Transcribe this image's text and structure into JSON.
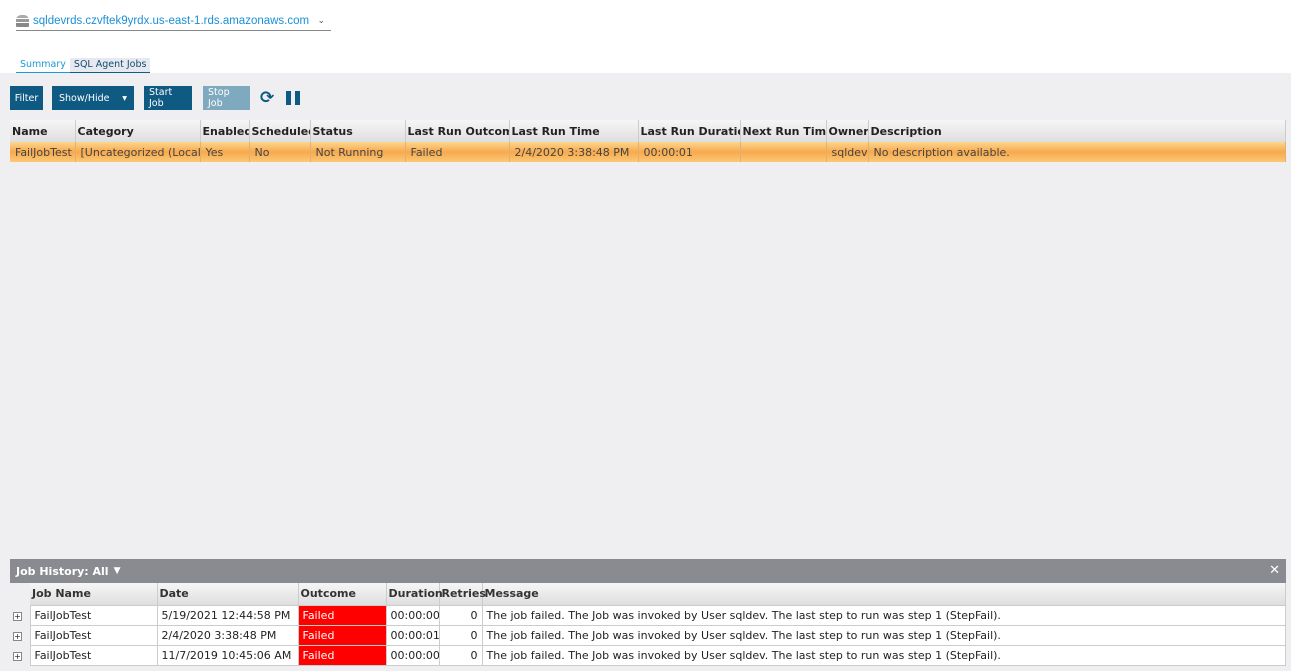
{
  "server": {
    "name": "sqldevrds.czvftek9yrdx.us-east-1.rds.amazonaws.com"
  },
  "tabs": [
    "Summary",
    "SQL Agent Jobs"
  ],
  "toolbar": {
    "filter": "Filter",
    "show_hide": "Show/Hide",
    "start_job": "Start Job",
    "stop_job": "Stop Job"
  },
  "jobs": {
    "columns": [
      "Name",
      "Category",
      "Enabled",
      "Scheduled",
      "Status",
      "Last Run Outcome",
      "Last Run Time",
      "Last Run Duration",
      "Next Run Time",
      "Owner",
      "Description"
    ],
    "rows": [
      [
        "FailJobTest",
        "[Uncategorized (Local)]",
        "Yes",
        "No",
        "Not Running",
        "Failed",
        "2/4/2020 3:38:48 PM",
        "00:00:01",
        "",
        "sqldev",
        "No description available."
      ]
    ]
  },
  "history": {
    "title": "Job History: All",
    "columns": [
      "Job Name",
      "Date",
      "Outcome",
      "Duration",
      "Retries",
      "Message"
    ],
    "rows": [
      [
        "FailJobTest",
        "5/19/2021 12:44:58 PM",
        "Failed",
        "00:00:00",
        "0",
        "The job failed.  The Job was invoked by User sqldev.  The last step to run was step 1 (StepFail)."
      ],
      [
        "FailJobTest",
        "2/4/2020 3:38:48 PM",
        "Failed",
        "00:00:01",
        "0",
        "The job failed.  The Job was invoked by User sqldev.  The last step to run was step 1 (StepFail)."
      ],
      [
        "FailJobTest",
        "11/7/2019 10:45:06 AM",
        "Failed",
        "00:00:00",
        "0",
        "The job failed.  The Job was invoked by User sqldev.  The last step to run was step 1 (StepFail)."
      ]
    ]
  },
  "colors": {
    "accent": "#0e5a82",
    "selected_row": "#f8a94c",
    "failed": "#fe0000"
  }
}
